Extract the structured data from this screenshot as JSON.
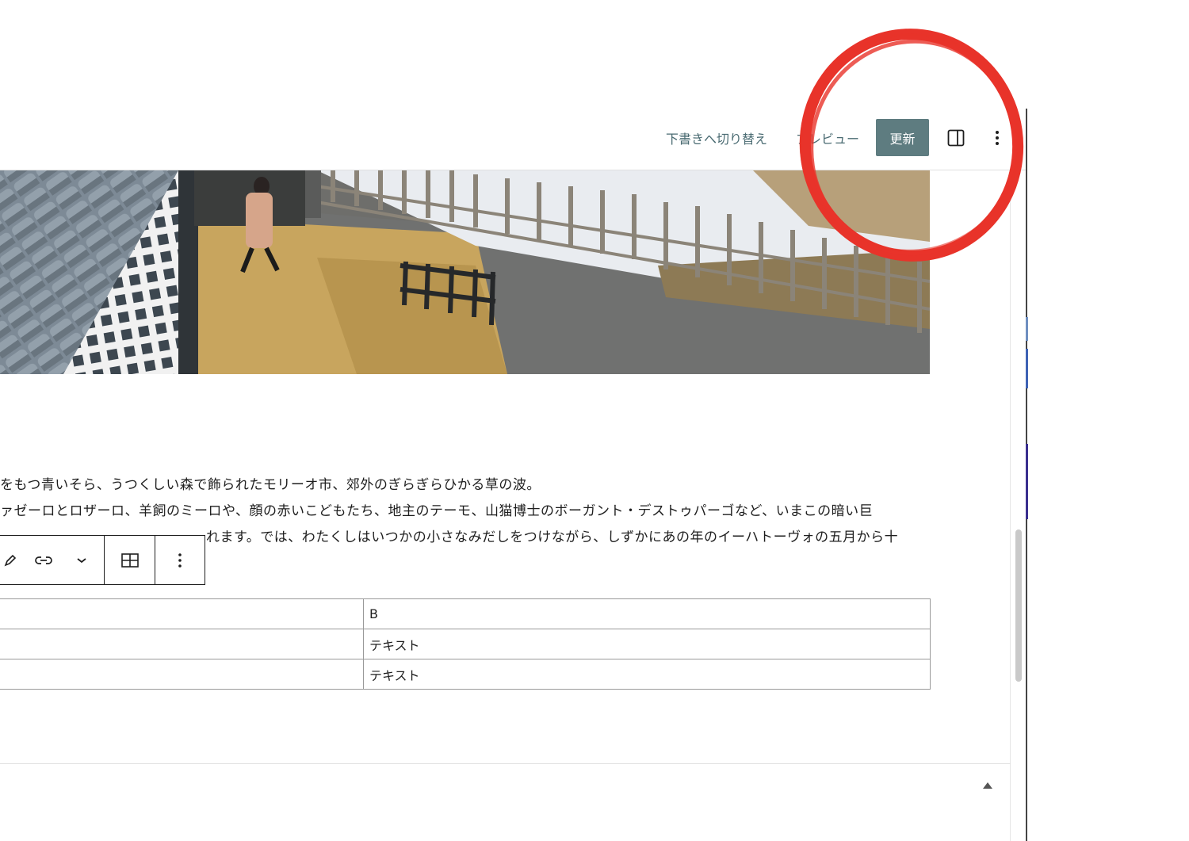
{
  "header": {
    "switch_to_draft_label": "下書きへ切り替え",
    "preview_label": "プレビュー",
    "update_label": "更新",
    "settings_icon": "sidebar-panel-icon",
    "options_icon": "vertical-ellipsis-icon"
  },
  "content": {
    "paragraph_lines": [
      "をもつ青いそら、うつくしい森で飾られたモリーオ市、郊外のぎらぎらひかる草の波。",
      "ァゼーロとロザーロ、羊飼のミーロや、顔の赤いこどもたち、地主のテーモ、山猫博士のボーガント・デストゥパーゴなど、いまこの暗い巨",
      "れます。では、わたくしはいつかの小さなみだしをつけながら、しずかにあの年のイーハトーヴォの五月から十"
    ]
  },
  "block_toolbar": {
    "icons": [
      "pencil-icon",
      "link-icon",
      "chevron-down-icon",
      "table-icon",
      "vertical-ellipsis-icon"
    ]
  },
  "table": {
    "rows": [
      [
        "",
        "B"
      ],
      [
        "",
        "テキスト"
      ],
      [
        "",
        "テキスト"
      ]
    ]
  },
  "colors": {
    "update_button": "#5e7c80",
    "link_text": "#4a6b72",
    "annotation_circle": "#e8332a"
  }
}
